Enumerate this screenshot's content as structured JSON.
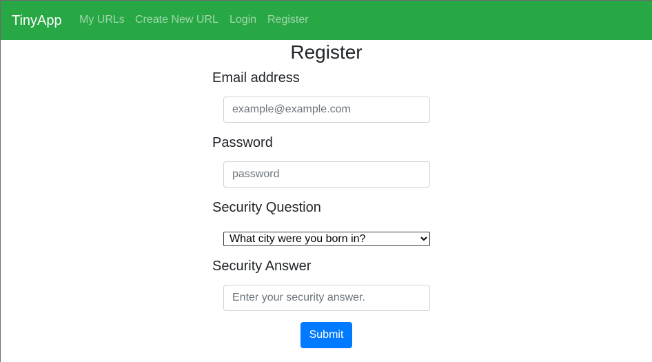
{
  "navbar": {
    "brand": "TinyApp",
    "links": [
      {
        "label": "My URLs"
      },
      {
        "label": "Create New URL"
      },
      {
        "label": "Login"
      },
      {
        "label": "Register"
      }
    ],
    "background": "#28a745"
  },
  "form": {
    "title": "Register",
    "email": {
      "label": "Email address",
      "placeholder": "example@example.com",
      "value": ""
    },
    "password": {
      "label": "Password",
      "placeholder": "password",
      "value": ""
    },
    "security_question": {
      "label": "Security Question",
      "selected": "What city were you born in?"
    },
    "security_answer": {
      "label": "Security Answer",
      "placeholder": "Enter your security answer.",
      "value": ""
    },
    "submit_label": "Submit",
    "submit_color": "#007bff"
  }
}
